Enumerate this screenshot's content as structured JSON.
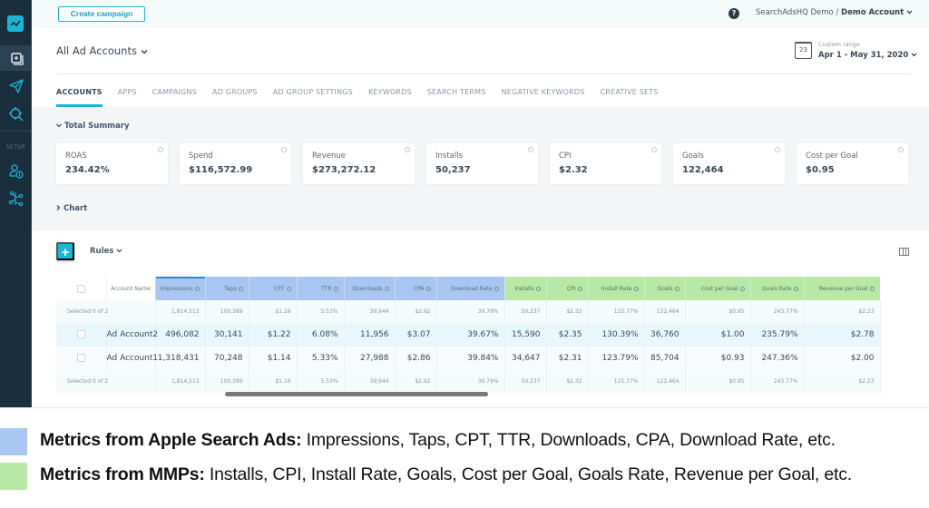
{
  "sidebar": {
    "logo_icon": "chart-line-logo-icon",
    "items": [
      {
        "name": "dashboard",
        "icon": "ad-accounts-icon",
        "active": true
      },
      {
        "name": "campaigns",
        "icon": "paper-plane-icon",
        "active": false
      },
      {
        "name": "keywords",
        "icon": "target-search-icon",
        "active": false
      }
    ],
    "setup_label": "SETUP",
    "setup_items": [
      {
        "name": "users",
        "icon": "user-billing-icon"
      },
      {
        "name": "integrations",
        "icon": "integrations-icon"
      }
    ]
  },
  "topbar": {
    "create_campaign_label": "Create campaign",
    "help_label": "?",
    "org_name": "SearchAdsHQ Demo",
    "separator": " / ",
    "account_name": "Demo Account"
  },
  "header": {
    "account_selector": "All Ad Accounts",
    "date_range_label": "Custom range",
    "date_range_value": "Apr 1 - May 31, 2020",
    "calendar_day": "23"
  },
  "tabs": [
    {
      "label": "ACCOUNTS",
      "active": true
    },
    {
      "label": "APPS"
    },
    {
      "label": "CAMPAIGNS"
    },
    {
      "label": "AD GROUPS"
    },
    {
      "label": "AD GROUP SETTINGS"
    },
    {
      "label": "KEYWORDS"
    },
    {
      "label": "SEARCH TERMS"
    },
    {
      "label": "NEGATIVE KEYWORDS"
    },
    {
      "label": "CREATIVE SETS"
    }
  ],
  "summary": {
    "title": "Total Summary",
    "chart_toggle": "Chart",
    "cards": [
      {
        "label": "ROAS",
        "value": "234.42%"
      },
      {
        "label": "Spend",
        "value": "$116,572.99"
      },
      {
        "label": "Revenue",
        "value": "$273,272.12"
      },
      {
        "label": "Installs",
        "value": "50,237"
      },
      {
        "label": "CPI",
        "value": "$2.32"
      },
      {
        "label": "Goals",
        "value": "122,464"
      },
      {
        "label": "Cost per Goal",
        "value": "$0.95"
      }
    ]
  },
  "toolbar": {
    "add_label": "+",
    "rules_label": "Rules"
  },
  "table": {
    "name_header": "Account Name",
    "columns": [
      {
        "label": "Impressions",
        "source": "asa"
      },
      {
        "label": "Taps",
        "source": "asa"
      },
      {
        "label": "CPT",
        "source": "asa"
      },
      {
        "label": "TTR",
        "source": "asa"
      },
      {
        "label": "Downloads",
        "source": "asa"
      },
      {
        "label": "CPA",
        "source": "asa"
      },
      {
        "label": "Download Rate",
        "source": "asa"
      },
      {
        "label": "Installs",
        "source": "mmp"
      },
      {
        "label": "CPI",
        "source": "mmp"
      },
      {
        "label": "Install Rate",
        "source": "mmp"
      },
      {
        "label": "Goals",
        "source": "mmp"
      },
      {
        "label": "Cost per Goal",
        "source": "mmp"
      },
      {
        "label": "Goals Rate",
        "source": "mmp"
      },
      {
        "label": "Revenue per Goal",
        "source": "mmp"
      }
    ],
    "selected_text": "Selected 0 of 2",
    "totals": [
      "1,814,513",
      "100,389",
      "$1.16",
      "5.53%",
      "39,944",
      "$2.92",
      "39.79%",
      "50,237",
      "$2.32",
      "125.77%",
      "122,464",
      "$0.95",
      "243.77%",
      "$2.23"
    ],
    "rows": [
      {
        "name": "Ad Account2",
        "values": [
          "496,082",
          "30,141",
          "$1.22",
          "6.08%",
          "11,956",
          "$3.07",
          "39.67%",
          "15,590",
          "$2.35",
          "130.39%",
          "36,760",
          "$1.00",
          "235.79%",
          "$2.78"
        ]
      },
      {
        "name": "Ad Account1",
        "values": [
          "1,318,431",
          "70,248",
          "$1.14",
          "5.33%",
          "27,988",
          "$2.86",
          "39.84%",
          "34,647",
          "$2.31",
          "123.79%",
          "85,704",
          "$0.93",
          "247.36%",
          "$2.00"
        ]
      }
    ]
  },
  "legend": {
    "asa_title": "Metrics from Apple Search Ads:",
    "asa_text": " Impressions, Taps, CPT, TTR, Downloads, CPA, Download Rate, etc.",
    "mmp_title": "Metrics from MMPs:",
    "mmp_text": " Installs, CPI, Install Rate, Goals, Cost per Goal, Goals Rate, Revenue per Goal, etc.",
    "asa_color": "#a9c6f3",
    "mmp_color": "#b7e8a6"
  }
}
